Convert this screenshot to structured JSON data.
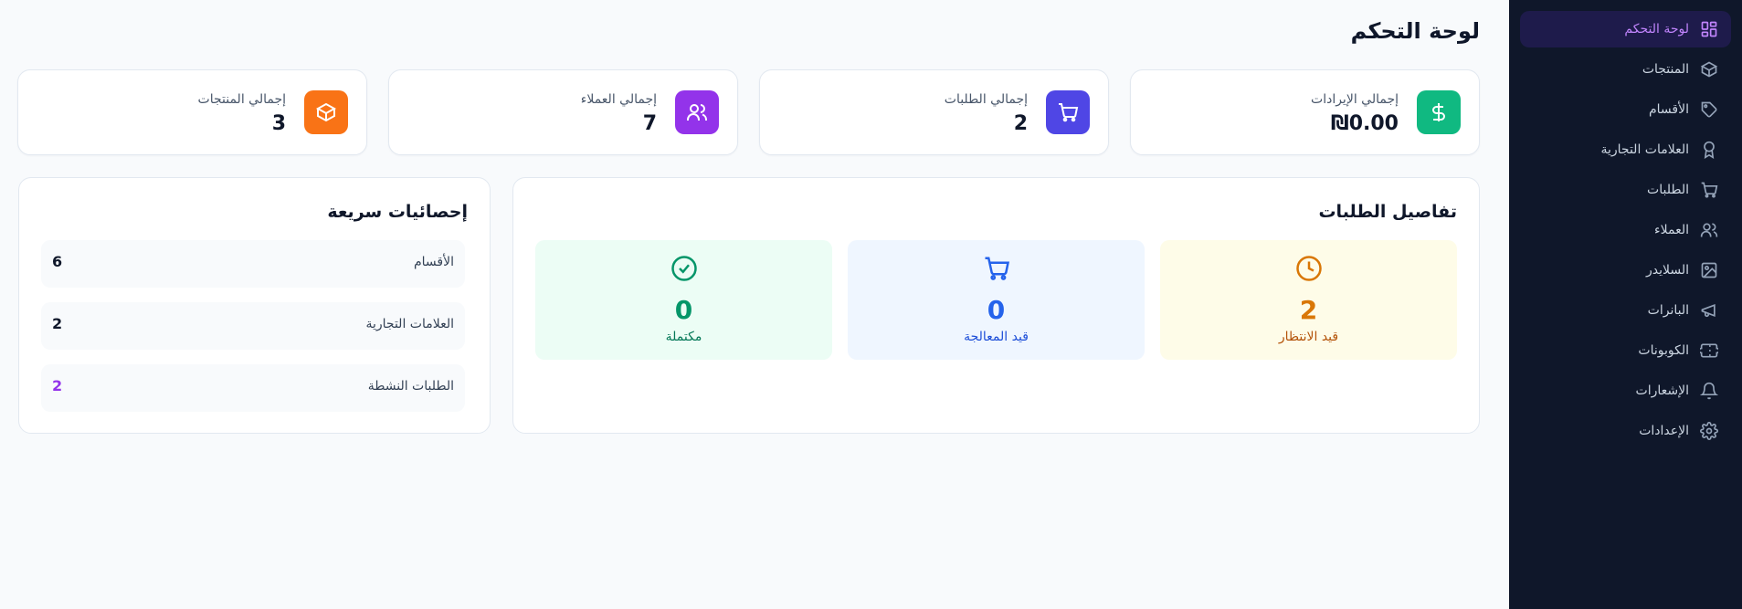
{
  "sidebar": {
    "items": [
      {
        "label": "لوحة التحكم",
        "icon": "dashboard-icon",
        "active": true
      },
      {
        "label": "المنتجات",
        "icon": "box-icon"
      },
      {
        "label": "الأقسام",
        "icon": "tag-icon"
      },
      {
        "label": "العلامات التجارية",
        "icon": "award-icon"
      },
      {
        "label": "الطلبات",
        "icon": "cart-icon"
      },
      {
        "label": "العملاء",
        "icon": "users-icon"
      },
      {
        "label": "السلايدر",
        "icon": "image-icon"
      },
      {
        "label": "البانرات",
        "icon": "megaphone-icon"
      },
      {
        "label": "الكوبونات",
        "icon": "ticket-icon"
      },
      {
        "label": "الإشعارات",
        "icon": "bell-icon"
      },
      {
        "label": "الإعدادات",
        "icon": "gear-icon"
      }
    ]
  },
  "header": {
    "title": "لوحة التحكم"
  },
  "stats": {
    "revenue": {
      "label": "إجمالي الإيرادات",
      "value": "₪0.00",
      "color": "#10b981"
    },
    "orders": {
      "label": "إجمالي الطلبات",
      "value": "2",
      "color": "#4f46e5"
    },
    "customers": {
      "label": "إجمالي العملاء",
      "value": "7",
      "color": "#9333ea"
    },
    "products": {
      "label": "إجمالي المنتجات",
      "value": "3",
      "color": "#f97316"
    }
  },
  "order_details": {
    "title": "تفاصيل الطلبات",
    "pending": {
      "count": "2",
      "label": "قيد الانتظار",
      "color": "#d97706",
      "bg": "#fefce8"
    },
    "processing": {
      "count": "0",
      "label": "قيد المعالجة",
      "color": "#2563eb",
      "bg": "#eff6ff"
    },
    "completed": {
      "count": "0",
      "label": "مكتملة",
      "color": "#059669",
      "bg": "#ecfdf5"
    }
  },
  "quick_stats": {
    "title": "إحصائيات سريعة",
    "rows": [
      {
        "label": "الأقسام",
        "value": "6"
      },
      {
        "label": "العلامات التجارية",
        "value": "2"
      },
      {
        "label": "الطلبات النشطة",
        "value": "2",
        "color": "#9333ea"
      }
    ]
  }
}
